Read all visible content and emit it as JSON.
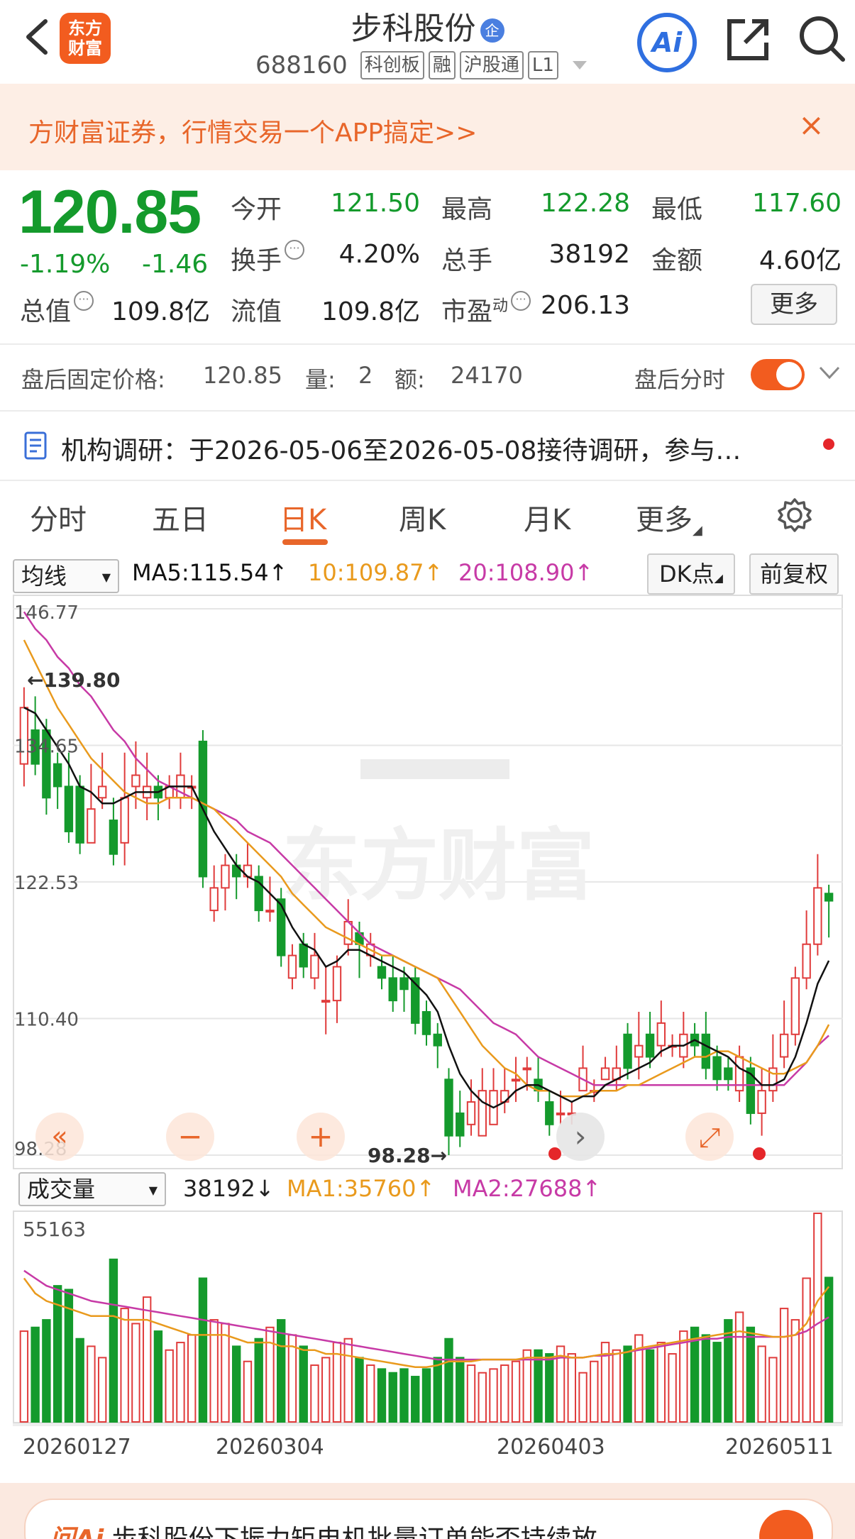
{
  "header": {
    "stock_name": "步科股份",
    "enterprise_badge": "企",
    "code": "688160",
    "tags": [
      "科创板",
      "融",
      "沪股通",
      "L1"
    ],
    "logo_line1": "东方",
    "logo_line2": "财富",
    "ai_label": "Ai"
  },
  "banner": {
    "text": "方财富证券，行情交易一个APP搞定>>",
    "close": "×"
  },
  "quote": {
    "price": "120.85",
    "change_pct": "-1.19%",
    "change": "-1.46",
    "open_label": "今开",
    "open": "121.50",
    "high_label": "最高",
    "high": "122.28",
    "low_label": "最低",
    "low": "117.60",
    "turnover_label": "换手",
    "turnover": "4.20%",
    "volume_label": "总手",
    "volume": "38192",
    "amount_label": "金额",
    "amount": "4.60亿",
    "mktcap_label": "总值",
    "mktcap": "109.8亿",
    "float_label": "流值",
    "float": "109.8亿",
    "pe_label": "市盈",
    "pe_sup": "动",
    "pe": "206.13",
    "more": "更多"
  },
  "after_hours": {
    "price_label": "盘后固定价格:",
    "price": "120.85",
    "vol_label": "量:",
    "vol": "2",
    "amt_label": "额:",
    "amt": "24170",
    "toggle_label": "盘后分时"
  },
  "research": {
    "text": "机构调研：于2026-05-06至2026-05-08接待调研，参与…"
  },
  "tabs": [
    "分时",
    "五日",
    "日K",
    "周K",
    "月K",
    "更多"
  ],
  "active_tab": "日K",
  "ma_legend": {
    "select": "均线",
    "ma5": "MA5:115.54↑",
    "ma10": "10:109.87↑",
    "ma20": "20:108.90↑",
    "dk": "DK点",
    "adjust": "前复权"
  },
  "volume_legend": {
    "select": "成交量",
    "vol": "38192↓",
    "ma1": "MA1:35760↑",
    "ma2": "MA2:27688↑"
  },
  "colors": {
    "up": "#e03b3b",
    "down": "#149a2c",
    "ma5": "#111111",
    "ma10": "#e99a1d",
    "ma20": "#c73aa6",
    "accent": "#e8662a"
  },
  "chart_data": [
    {
      "type": "candlestick",
      "y_ticks": [
        "146.77",
        "134.65",
        "122.53",
        "110.40",
        "98.28"
      ],
      "ylim": [
        98.28,
        146.77
      ],
      "annotations": [
        "←139.80",
        "98.28→"
      ],
      "watermark": "东方财富",
      "candles": [
        [
          133,
          138,
          131,
          139.8
        ],
        [
          136,
          133,
          132,
          139
        ],
        [
          136,
          130,
          128.5,
          137
        ],
        [
          133,
          131,
          129,
          134
        ],
        [
          131,
          127,
          126,
          134
        ],
        [
          131,
          126,
          125,
          132
        ],
        [
          126,
          129,
          127,
          133
        ],
        [
          130,
          131,
          129,
          134
        ],
        [
          128,
          125,
          124,
          130
        ],
        [
          126,
          130,
          124,
          134
        ],
        [
          131,
          132,
          129,
          135
        ],
        [
          130,
          131,
          128,
          134
        ],
        [
          131,
          130,
          128,
          132
        ],
        [
          130,
          131,
          129,
          132
        ],
        [
          130,
          132,
          129,
          134
        ],
        [
          131,
          131,
          129,
          132
        ],
        [
          135,
          123,
          122,
          136
        ],
        [
          120,
          122,
          119,
          124
        ],
        [
          122,
          124,
          120,
          125
        ],
        [
          124,
          123,
          121,
          125
        ],
        [
          123,
          124,
          122,
          126
        ],
        [
          123,
          120,
          119,
          124
        ],
        [
          120,
          120,
          119,
          123
        ],
        [
          121,
          116,
          115,
          122
        ],
        [
          114,
          116,
          113,
          117
        ],
        [
          117,
          115,
          114,
          118
        ],
        [
          114,
          116,
          113,
          118
        ],
        [
          112,
          112,
          109,
          115
        ],
        [
          112,
          115,
          110,
          116
        ],
        [
          117,
          119,
          116,
          121
        ],
        [
          118,
          117,
          114,
          119
        ],
        [
          116,
          117,
          115,
          118
        ],
        [
          115,
          114,
          113,
          116
        ],
        [
          114,
          112,
          111,
          116
        ],
        [
          114,
          113,
          111,
          115
        ],
        [
          114,
          110,
          109,
          115
        ],
        [
          111,
          109,
          108,
          112
        ],
        [
          109,
          108,
          106,
          110
        ],
        [
          105,
          100,
          98.28,
          106
        ],
        [
          102,
          100,
          99,
          104
        ],
        [
          101,
          103,
          100,
          105
        ],
        [
          100,
          104,
          101,
          106
        ],
        [
          101,
          104,
          102,
          106
        ],
        [
          103,
          104,
          102,
          106
        ],
        [
          105,
          105,
          103,
          107
        ],
        [
          106,
          106,
          104,
          107
        ],
        [
          105,
          104,
          103,
          107
        ],
        [
          103,
          101,
          100,
          104
        ],
        [
          102,
          102,
          101,
          104
        ],
        [
          102,
          102,
          101,
          103
        ],
        [
          104,
          106,
          104,
          108
        ],
        [
          104,
          104,
          103,
          105
        ],
        [
          105,
          106,
          105,
          107
        ],
        [
          105,
          106,
          104,
          108
        ],
        [
          109,
          106,
          105,
          110
        ],
        [
          107,
          108,
          105,
          111
        ],
        [
          109,
          107,
          106,
          111
        ],
        [
          108,
          110,
          107,
          112
        ],
        [
          108,
          108,
          107,
          109
        ],
        [
          107,
          109,
          106,
          111
        ],
        [
          109,
          108,
          107,
          110
        ],
        [
          109,
          106,
          105,
          111
        ],
        [
          107,
          105,
          104,
          108
        ],
        [
          106,
          105,
          104,
          107
        ],
        [
          104,
          107,
          103,
          108
        ],
        [
          106,
          102,
          101,
          107
        ],
        [
          102,
          104,
          100,
          106
        ],
        [
          104,
          106,
          103,
          109
        ],
        [
          107,
          109,
          106,
          112
        ],
        [
          109,
          114,
          108,
          115
        ],
        [
          114,
          117,
          113,
          120
        ],
        [
          117,
          122,
          116,
          125
        ],
        [
          121.5,
          120.85,
          117.6,
          122.28
        ]
      ],
      "ma5": [
        138,
        137.5,
        136,
        134.5,
        133,
        131,
        130.5,
        129.5,
        129.5,
        130,
        130.5,
        130.5,
        130.5,
        131,
        131,
        131,
        129,
        127,
        125.5,
        124,
        123,
        122.5,
        121.5,
        120.5,
        118.5,
        117,
        116.5,
        115,
        115.5,
        116.5,
        116.5,
        116,
        115.5,
        115,
        114.5,
        113.5,
        112.5,
        111,
        108,
        105.5,
        104,
        103,
        102.5,
        103,
        104,
        104.5,
        104.5,
        104,
        103.5,
        103,
        103.5,
        103.5,
        104.5,
        105,
        105.5,
        106,
        106.5,
        107.5,
        108,
        108,
        108.5,
        108,
        107.5,
        107,
        106,
        105.5,
        104.5,
        104.5,
        105,
        107,
        110,
        113.5,
        115.54
      ],
      "ma10": [
        144,
        142,
        140,
        138,
        136.5,
        135,
        133.5,
        132.5,
        131.5,
        130.5,
        130,
        129.5,
        129.5,
        130,
        130,
        130,
        129.5,
        129,
        128,
        127,
        126,
        125,
        124,
        123,
        121.5,
        120.5,
        119.5,
        118.5,
        118,
        117.5,
        117,
        116.5,
        116,
        116,
        115.5,
        115,
        114.5,
        114,
        112.5,
        111,
        109.5,
        108,
        107,
        106,
        105.5,
        104.5,
        104,
        104,
        103.5,
        103.5,
        103.5,
        104,
        104,
        104,
        104.5,
        104.5,
        105,
        105.5,
        106,
        106.5,
        107,
        107,
        107.5,
        107.5,
        107,
        106.5,
        106,
        105.5,
        105.5,
        106,
        106.5,
        108,
        109.87
      ],
      "ma20": [
        146.5,
        145,
        144,
        142.5,
        141.5,
        140,
        139,
        137.5,
        136,
        135,
        133.5,
        132.5,
        131.5,
        131,
        130.5,
        130,
        129.5,
        129,
        128.5,
        128,
        127,
        126.5,
        126,
        125,
        124,
        123,
        122,
        121,
        120,
        119,
        118,
        117,
        116.5,
        116,
        115.5,
        115,
        114.5,
        114,
        113.5,
        113,
        112,
        111,
        110,
        109.5,
        109,
        108,
        107,
        106.5,
        106,
        105.5,
        105,
        104.5,
        104.5,
        104.5,
        104.5,
        104.5,
        104.5,
        104.5,
        104.5,
        104.5,
        104.5,
        104.5,
        104.5,
        104.5,
        104.5,
        104.5,
        104.5,
        104.5,
        104.5,
        105.5,
        106.5,
        108,
        108.9
      ]
    },
    {
      "type": "bar",
      "y_ticks": [
        "55163"
      ],
      "ylim": [
        0,
        55163
      ],
      "x_labels": [
        "20260127",
        "20260304",
        "20260403",
        "20260511"
      ],
      "volumes": [
        24000,
        25000,
        27000,
        36000,
        35000,
        22000,
        20000,
        17000,
        43000,
        30000,
        26000,
        33000,
        24000,
        19000,
        21000,
        23000,
        38000,
        27000,
        26000,
        20000,
        16000,
        22000,
        25000,
        27000,
        23000,
        20000,
        15000,
        17000,
        21000,
        22000,
        17000,
        15000,
        14000,
        13000,
        14000,
        12000,
        14000,
        17000,
        22000,
        17000,
        15000,
        13000,
        14000,
        15000,
        16000,
        19000,
        19000,
        18000,
        20000,
        18000,
        13000,
        16000,
        21000,
        19000,
        20000,
        23000,
        19000,
        21000,
        18000,
        24000,
        25000,
        23000,
        21000,
        27000,
        29000,
        25000,
        20000,
        17000,
        30000,
        27000,
        38000,
        55163,
        38192
      ],
      "ma1": [
        38000,
        34000,
        32000,
        31000,
        30000,
        29000,
        28000,
        28000,
        28000,
        27000,
        27000,
        27000,
        26000,
        25000,
        24000,
        23000,
        23000,
        23000,
        23000,
        22000,
        21000,
        21000,
        21000,
        20000,
        20000,
        19000,
        19000,
        18000,
        18000,
        17500,
        17000,
        16500,
        16000,
        15500,
        15000,
        14500,
        14500,
        15000,
        16000,
        16000,
        16000,
        16500,
        16500,
        16500,
        16500,
        17000,
        17000,
        17000,
        17500,
        17000,
        17000,
        17500,
        18000,
        18000,
        18500,
        19500,
        20000,
        20500,
        21000,
        21500,
        22000,
        22500,
        23000,
        23500,
        24000,
        23500,
        23000,
        22500,
        22500,
        23000,
        26000,
        32000,
        35760
      ],
      "ma2": [
        40000,
        38000,
        36000,
        35000,
        34000,
        33000,
        32000,
        31500,
        31000,
        30500,
        30000,
        29500,
        29000,
        28500,
        28000,
        27500,
        27000,
        26500,
        26000,
        25500,
        25000,
        24500,
        24000,
        23500,
        23000,
        22500,
        22000,
        21500,
        21000,
        20500,
        20000,
        19500,
        19000,
        18500,
        18000,
        17500,
        17000,
        16500,
        16500,
        16500,
        16500,
        16500,
        16500,
        16500,
        16500,
        16500,
        16500,
        16500,
        17000,
        17000,
        17000,
        17500,
        17500,
        18000,
        18500,
        19000,
        19500,
        20000,
        20500,
        21000,
        21500,
        22000,
        22000,
        22500,
        22500,
        22500,
        22500,
        22500,
        22500,
        23000,
        24000,
        26000,
        27688
      ]
    }
  ],
  "controls": {
    "prev": "«",
    "zoom_out": "−",
    "zoom_in": "+",
    "next": "›",
    "expand": "⤢"
  },
  "promo": {
    "ai": "问Ai",
    "text": "步科股份下振力矩电机批量订单能否持续放"
  }
}
